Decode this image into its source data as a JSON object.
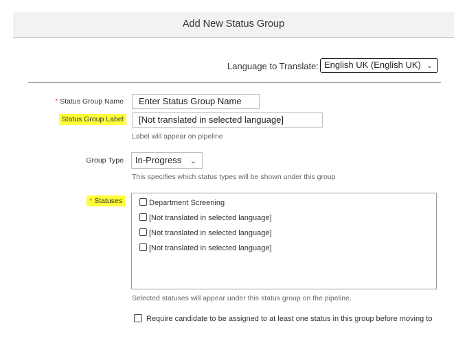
{
  "dialog": {
    "title": "Add New Status Group"
  },
  "language": {
    "label": "Language to Translate:",
    "selected": "English UK (English UK)"
  },
  "form": {
    "name": {
      "required_mark": "*",
      "label": "Status Group Name",
      "value": "Enter Status Group Name"
    },
    "group_label": {
      "label": "Status Group Label",
      "value": "[Not translated in selected language]",
      "hint": "Label will appear on pipeline"
    },
    "group_type": {
      "label": "Group Type",
      "selected": "In-Progress",
      "hint": "This specifies which status types will be shown under this group"
    },
    "statuses": {
      "required_mark": "*",
      "label": "Statuses",
      "items": [
        {
          "label": "Department Screening",
          "checked": false
        },
        {
          "label": "[Not translated in selected language]",
          "checked": false
        },
        {
          "label": "[Not translated in selected language]",
          "checked": false
        },
        {
          "label": "[Not translated in selected language]",
          "checked": false
        }
      ],
      "hint": "Selected statuses will appear under this status group on the pipeline."
    },
    "require_option": {
      "label": "Require candidate to be assigned to at least one status in this group before moving to",
      "checked": false
    }
  },
  "colors": {
    "highlight": "#ffff3a",
    "required": "#d9534f"
  }
}
